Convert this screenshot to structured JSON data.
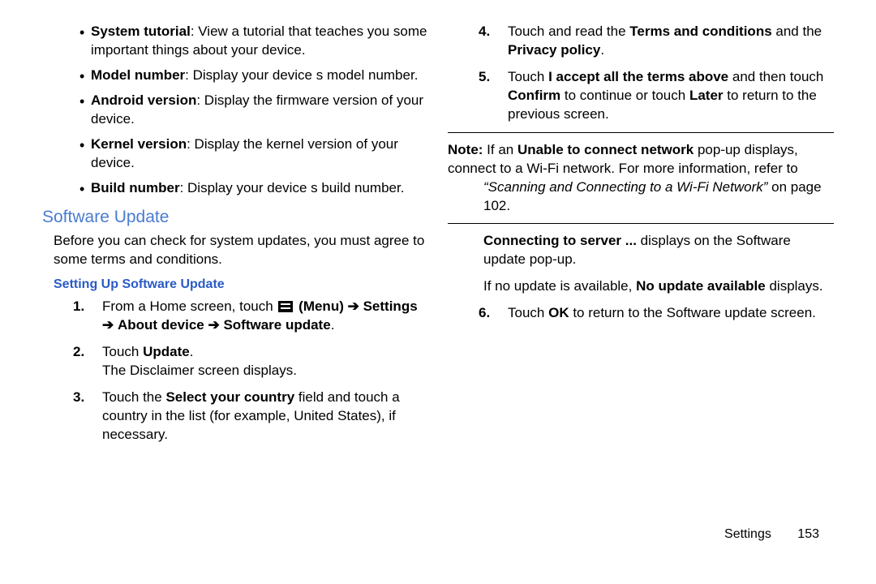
{
  "left": {
    "bullets": [
      {
        "label": "System tutorial",
        "text": ": View a tutorial that teaches you some important things about your device."
      },
      {
        "label": "Model number",
        "text": ": Display your device s model number."
      },
      {
        "label": "Android version",
        "text": ": Display the firmware version of your device."
      },
      {
        "label": "Kernel version",
        "text": ": Display the kernel version of your device."
      },
      {
        "label": "Build number",
        "text": ": Display your device s build number."
      }
    ],
    "heading": "Software Update",
    "intro": "Before you can check for system updates, you must agree to some terms and conditions.",
    "subhead": "Setting Up Software Update",
    "steps": {
      "s1_num": "1.",
      "s1_a": "From a Home screen, touch ",
      "s1_menu": "(Menu)",
      "s1_arrow1": "➔",
      "s1_b": " Settings ",
      "s1_arrow2": "➔",
      "s1_c": " About device ",
      "s1_arrow3": "➔",
      "s1_d": " Software update",
      "s1_end": ".",
      "s2_num": "2.",
      "s2_a": "Touch ",
      "s2_b": "Update",
      "s2_c": ".",
      "s2_d": "The Disclaimer screen displays.",
      "s3_num": "3.",
      "s3_a": "Touch the ",
      "s3_b": "Select your country",
      "s3_c": " field and touch a country in the list (for example, United States), if necessary."
    }
  },
  "right": {
    "s4_num": "4.",
    "s4_a": "Touch and read the ",
    "s4_b": "Terms and conditions",
    "s4_c": " and the ",
    "s4_d": "Privacy policy",
    "s4_e": ".",
    "s5_num": "5.",
    "s5_a": "Touch ",
    "s5_b": "I accept all the terms above",
    "s5_c": " and then touch ",
    "s5_d": "Confirm",
    "s5_e": " to continue or touch ",
    "s5_f": "Later",
    "s5_g": " to return to the previous screen.",
    "note_label": "Note:",
    "note_a": " If an ",
    "note_b": "Unable to connect network",
    "note_c": " pop-up displays, connect to a Wi-Fi network. For more information, refer to ",
    "note_ref": "“Scanning and Connecting to a Wi-Fi Network”",
    "note_d": "  on page 102.",
    "p1_a": "Connecting to server ...",
    "p1_b": " displays on the Software update pop-up.",
    "p2_a": "If no update is available, ",
    "p2_b": "No update available",
    "p2_c": " displays.",
    "s6_num": "6.",
    "s6_a": "Touch ",
    "s6_b": "OK",
    "s6_c": " to return to the Software update screen."
  },
  "footer": {
    "section": "Settings",
    "page": "153"
  }
}
